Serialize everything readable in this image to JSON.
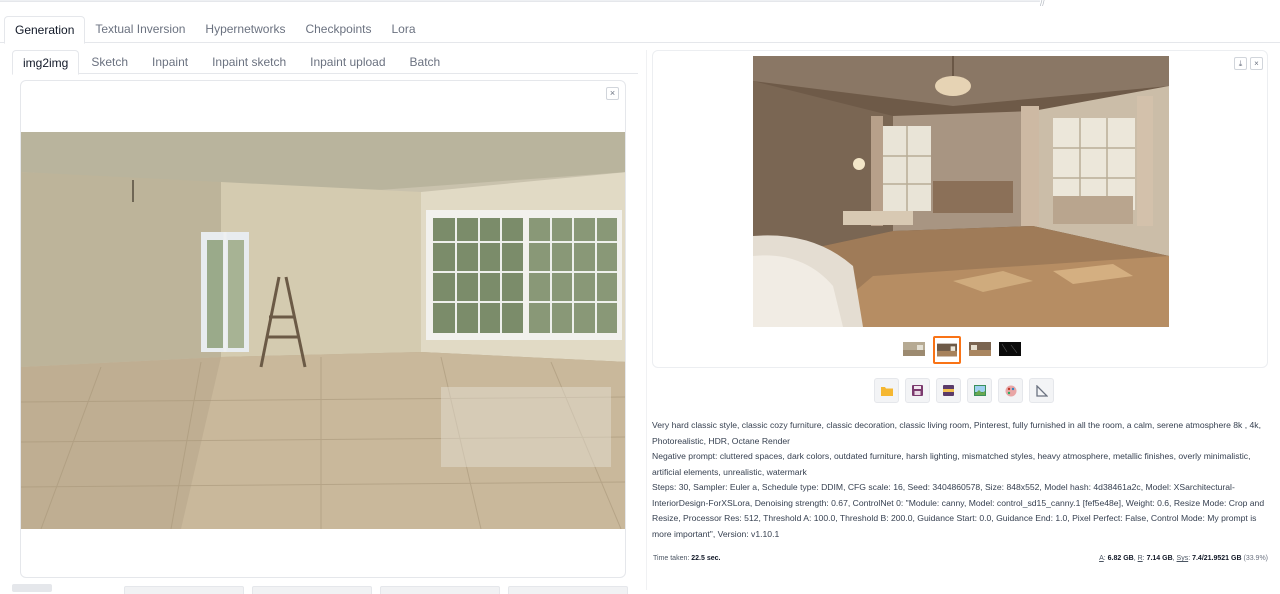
{
  "main_tabs": [
    "Generation",
    "Textual Inversion",
    "Hypernetworks",
    "Checkpoints",
    "Lora"
  ],
  "sub_tabs": [
    "img2img",
    "Sketch",
    "Inpaint",
    "Inpaint sketch",
    "Inpaint upload",
    "Batch"
  ],
  "input_close": "×",
  "gallery_icons": {
    "download": "⤓",
    "close": "×"
  },
  "generation_info": {
    "prompt": "Very hard classic style, classic cozy furniture, classic decoration, classic living room, Pinterest, fully furnished in all the room, a calm, serene atmosphere 8k , 4k, Photorealistic, HDR, Octane Render",
    "negative": "Negative prompt: cluttered spaces, dark colors, outdated furniture, harsh lighting, mismatched styles, heavy atmosphere, metallic finishes, overly minimalistic, artificial elements, unrealistic, watermark",
    "params": "Steps: 30, Sampler: Euler a, Schedule type: DDIM, CFG scale: 16, Seed: 3404860578, Size: 848x552, Model hash: 4d38461a2c, Model: XSarchitectural-InteriorDesign-ForXSLora, Denoising strength: 0.67, ControlNet 0: \"Module: canny, Model: control_sd15_canny.1 [fef5e48e], Weight: 0.6, Resize Mode: Crop and Resize, Processor Res: 512, Threshold A: 100.0, Threshold B: 200.0, Guidance Start: 0.0, Guidance End: 1.0, Pixel Perfect: False, Control Mode: My prompt is more important\", Version: v1.10.1"
  },
  "time_info": {
    "label": "Time taken:",
    "value": "22.5 sec.",
    "a_label": "A",
    "a_value": "6.82 GB",
    "r_label": "R",
    "r_value": "7.14 GB",
    "sys_label": "Sys",
    "sys_value": "7.4/21.9521 GB",
    "sys_pct": "(33.9%)"
  },
  "actions": [
    "folder-icon",
    "save-icon",
    "zip-icon",
    "send-to-img2img-icon",
    "send-to-inpaint-icon",
    "send-to-extras-icon"
  ],
  "colors": {
    "accent": "#f97316",
    "border": "#e5e7eb"
  }
}
